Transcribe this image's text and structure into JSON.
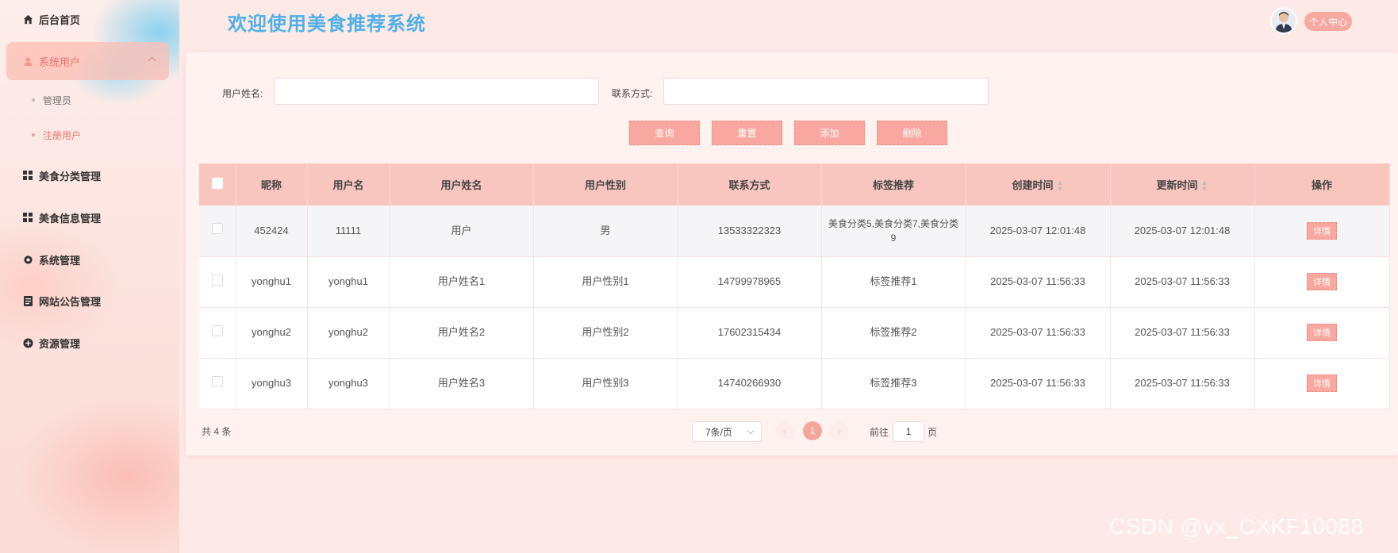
{
  "sidebar": {
    "items": [
      {
        "label": "后台首页",
        "icon": "home-icon"
      },
      {
        "label": "系统用户",
        "icon": "user-icon"
      },
      {
        "label": "美食分类管理",
        "icon": "grid-icon"
      },
      {
        "label": "美食信息管理",
        "icon": "grid-icon"
      },
      {
        "label": "系统管理",
        "icon": "gear-icon"
      },
      {
        "label": "网站公告管理",
        "icon": "notice-icon"
      },
      {
        "label": "资源管理",
        "icon": "plus-circle-icon"
      }
    ],
    "sub_items": [
      {
        "label": "管理员"
      },
      {
        "label": "注册用户"
      }
    ]
  },
  "header": {
    "title": "欢迎使用美食推荐系统",
    "user_button": "个人中心"
  },
  "search": {
    "name_label": "用户姓名:",
    "name_value": "",
    "contact_label": "联系方式:",
    "contact_value": ""
  },
  "actions": {
    "query": "查询",
    "reset": "重置",
    "add": "添加",
    "delete": "删除"
  },
  "table": {
    "columns": [
      "昵称",
      "用户名",
      "用户姓名",
      "用户性别",
      "联系方式",
      "标签推荐",
      "创建时间",
      "更新时间",
      "操作"
    ],
    "detail_label": "详情",
    "rows": [
      {
        "nickname": "452424",
        "username": "11111",
        "realname": "用户",
        "gender": "男",
        "phone": "13533322323",
        "tags": "美食分类5,美食分类7,美食分类9",
        "created": "2025-03-07 12:01:48",
        "updated": "2025-03-07 12:01:48"
      },
      {
        "nickname": "yonghu1",
        "username": "yonghu1",
        "realname": "用户姓名1",
        "gender": "用户性别1",
        "phone": "14799978965",
        "tags": "标签推荐1",
        "created": "2025-03-07 11:56:33",
        "updated": "2025-03-07 11:56:33"
      },
      {
        "nickname": "yonghu2",
        "username": "yonghu2",
        "realname": "用户姓名2",
        "gender": "用户性别2",
        "phone": "17602315434",
        "tags": "标签推荐2",
        "created": "2025-03-07 11:56:33",
        "updated": "2025-03-07 11:56:33"
      },
      {
        "nickname": "yonghu3",
        "username": "yonghu3",
        "realname": "用户姓名3",
        "gender": "用户性别3",
        "phone": "14740266930",
        "tags": "标签推荐3",
        "created": "2025-03-07 11:56:33",
        "updated": "2025-03-07 11:56:33"
      }
    ]
  },
  "pagination": {
    "total": "共 4 条",
    "page_size": "7条/页",
    "current_page": "1",
    "goto_prefix": "前往",
    "goto_value": "1",
    "goto_suffix": "页",
    "prev_arrow": "‹",
    "next_arrow": "›"
  },
  "watermark": "CSDN @vx_CXKF10088",
  "colors": {
    "accent": "#f8a8a0",
    "title": "#4fb0e8",
    "active_text": "#e8726a",
    "header_row": "#f9c6bf"
  }
}
